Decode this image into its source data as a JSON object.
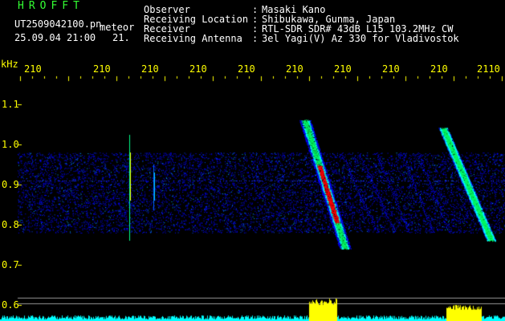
{
  "header": {
    "program_name": "HROFFT",
    "filename": "UT2509042100.pn",
    "event_label": "meteor",
    "datetime": "25.09.04 21:00",
    "tag": "21.",
    "fields": [
      {
        "label": "Observer",
        "value": "Masaki Kano"
      },
      {
        "label": "Receiving Location",
        "value": "Shibukawa, Gunma, Japan"
      },
      {
        "label": "Receiver",
        "value": "RTL-SDR SDR# 43dB L15 103.2MHz CW"
      },
      {
        "label": "Receiving Antenna",
        "value": "3el Yagi(V) Az 330 for Vladivostok"
      }
    ]
  },
  "chart_data": {
    "type": "heatmap",
    "ylabel": "kHz",
    "y_ticks": [
      "1.1",
      "1.0",
      "0.9",
      "0.8",
      "0.7",
      "0.6"
    ],
    "x_ticks": [
      "210",
      "210",
      "210",
      "210",
      "210",
      "210",
      "210",
      "210",
      "210",
      "2110"
    ],
    "ylim": [
      0.6,
      1.15
    ],
    "noise_band_khz": [
      0.78,
      0.98
    ],
    "carrier_khz": 0.91,
    "meteor_echoes": [
      {
        "start_khz": 1.06,
        "end_khz": 0.74,
        "intensity": "strong"
      },
      {
        "start_khz": 1.04,
        "end_khz": 0.76,
        "intensity": "medium"
      }
    ]
  },
  "colors": {
    "background": "#000000",
    "header_text": "#ffffff",
    "tick_text": "#ffff00",
    "program_text": "#33ff33",
    "signal_low": "#0000ff",
    "signal_mid": "#00ffff",
    "signal_high": "#ff0000",
    "power_trace": "#00ffff",
    "power_peak": "#ffff00"
  }
}
